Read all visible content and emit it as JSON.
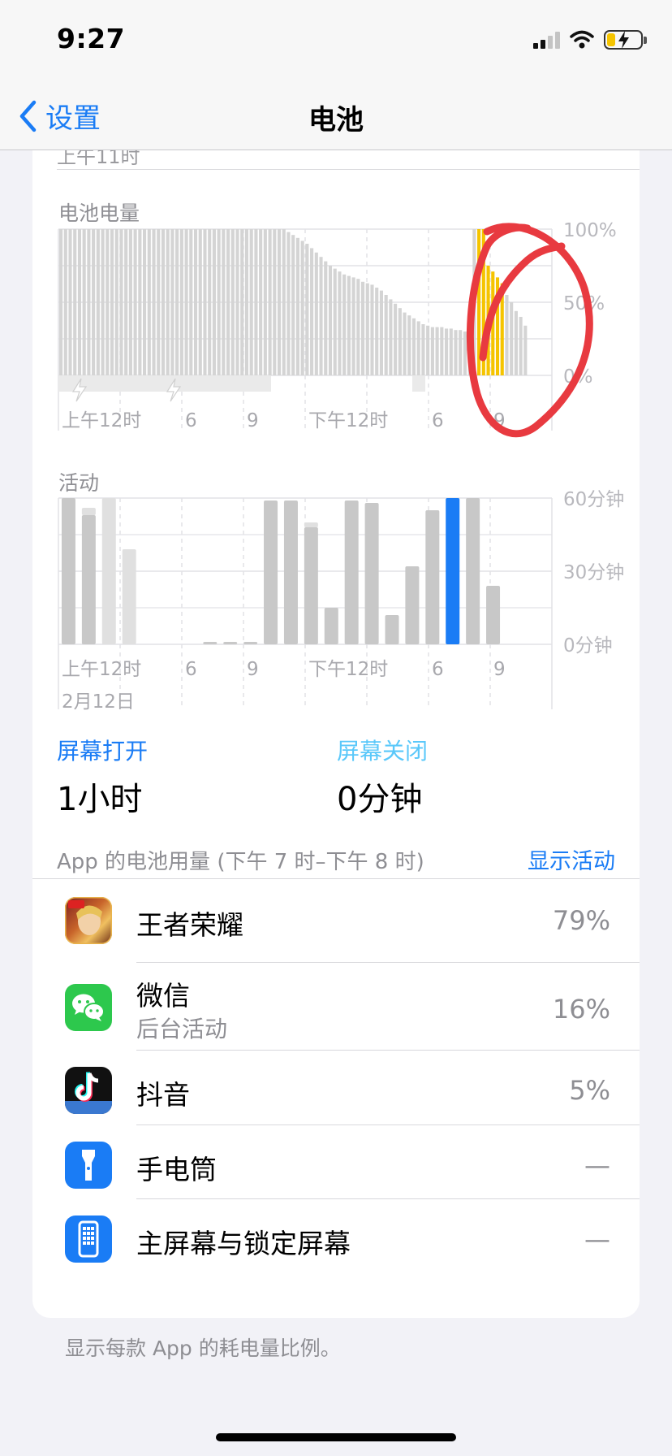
{
  "status": {
    "time": "9:27"
  },
  "nav": {
    "back_label": "设置",
    "title": "电池"
  },
  "clipped_label": "上午11时",
  "battery_section": {
    "title": "电池电量",
    "y_ticks": [
      "100%",
      "50%",
      "0%"
    ],
    "x_ticks": [
      "上午12时",
      "6",
      "9",
      "下午12时",
      "6",
      "9"
    ]
  },
  "activity_section": {
    "title": "活动",
    "y_ticks": [
      "60分钟",
      "30分钟",
      "0分钟"
    ],
    "x_ticks": [
      "上午12时",
      "6",
      "9",
      "下午12时",
      "6",
      "9"
    ],
    "date_label": "2月12日"
  },
  "chart_data": [
    {
      "type": "bar",
      "name": "battery_level",
      "unit": "%",
      "ylim": [
        0,
        100
      ],
      "y_ticks": [
        "100%",
        "50%",
        "0%"
      ],
      "x_ticks": [
        "上午12时",
        "6",
        "9",
        "下午12时",
        "6",
        "9"
      ],
      "values": [
        100,
        100,
        100,
        100,
        100,
        100,
        100,
        100,
        100,
        100,
        100,
        100,
        100,
        100,
        100,
        100,
        100,
        100,
        100,
        100,
        100,
        100,
        100,
        100,
        100,
        100,
        100,
        100,
        100,
        100,
        100,
        100,
        100,
        100,
        100,
        100,
        100,
        100,
        100,
        100,
        100,
        100,
        100,
        100,
        100,
        100,
        100,
        100,
        100,
        98,
        96,
        94,
        92,
        90,
        87,
        84,
        81,
        78,
        75,
        73,
        71,
        69,
        68,
        67,
        66,
        64,
        63,
        62,
        60,
        58,
        55,
        52,
        49,
        46,
        43,
        41,
        39,
        37,
        35,
        34,
        33,
        33,
        33,
        32,
        32,
        31,
        31,
        30,
        30,
        100,
        100,
        100,
        75,
        71,
        67,
        63,
        55,
        50,
        44,
        40,
        34
      ],
      "highlight_indices": [
        90,
        91,
        92,
        93,
        94,
        95
      ],
      "colors": {
        "normal": "#d4d4d4",
        "highlight": "#f5c400",
        "charging_band": "#eaeaea"
      }
    },
    {
      "type": "bar",
      "name": "activity",
      "unit": "分钟",
      "ylim": [
        0,
        60
      ],
      "y_ticks": [
        "60分钟",
        "30分钟",
        "0分钟"
      ],
      "x_ticks": [
        "上午12时",
        "6",
        "9",
        "下午12时",
        "6",
        "9"
      ],
      "values": [
        60,
        53,
        60,
        39,
        0,
        0,
        0,
        1,
        1,
        1,
        59,
        59,
        48,
        15,
        59,
        58,
        12,
        32,
        55,
        60,
        60,
        24
      ],
      "light_values": [
        0,
        3,
        0,
        0,
        0,
        0,
        0,
        0,
        0,
        0,
        0,
        0,
        2,
        0,
        0,
        0,
        0,
        0,
        0,
        0,
        0,
        0
      ],
      "highlight_index": 19,
      "colors": {
        "normal": "#c8c8c8",
        "light": "#e0e0e0",
        "highlight": "#1a7cf5"
      }
    }
  ],
  "screen_on": {
    "label": "屏幕打开",
    "value": "1小时",
    "color": "#1a7cf5"
  },
  "screen_off": {
    "label": "屏幕关闭",
    "value": "0分钟",
    "color": "#5ac8fa"
  },
  "usage": {
    "header": "App 的电池用量 (下午 7 时–下午 8 时)",
    "show_activity": "显示活动",
    "apps": [
      {
        "name": "王者荣耀",
        "sub": "",
        "percent": "79%",
        "icon": "game-icon"
      },
      {
        "name": "微信",
        "sub": "后台活动",
        "percent": "16%",
        "icon": "wechat-icon"
      },
      {
        "name": "抖音",
        "sub": "",
        "percent": "5%",
        "icon": "douyin-icon"
      },
      {
        "name": "手电筒",
        "sub": "",
        "percent": "—",
        "icon": "flashlight-icon"
      },
      {
        "name": "主屏幕与锁定屏幕",
        "sub": "",
        "percent": "—",
        "icon": "home-lock-screen-icon"
      }
    ]
  },
  "footer_note": "显示每款 App 的耗电量比例。",
  "annotation": {
    "color": "#e83a40"
  }
}
